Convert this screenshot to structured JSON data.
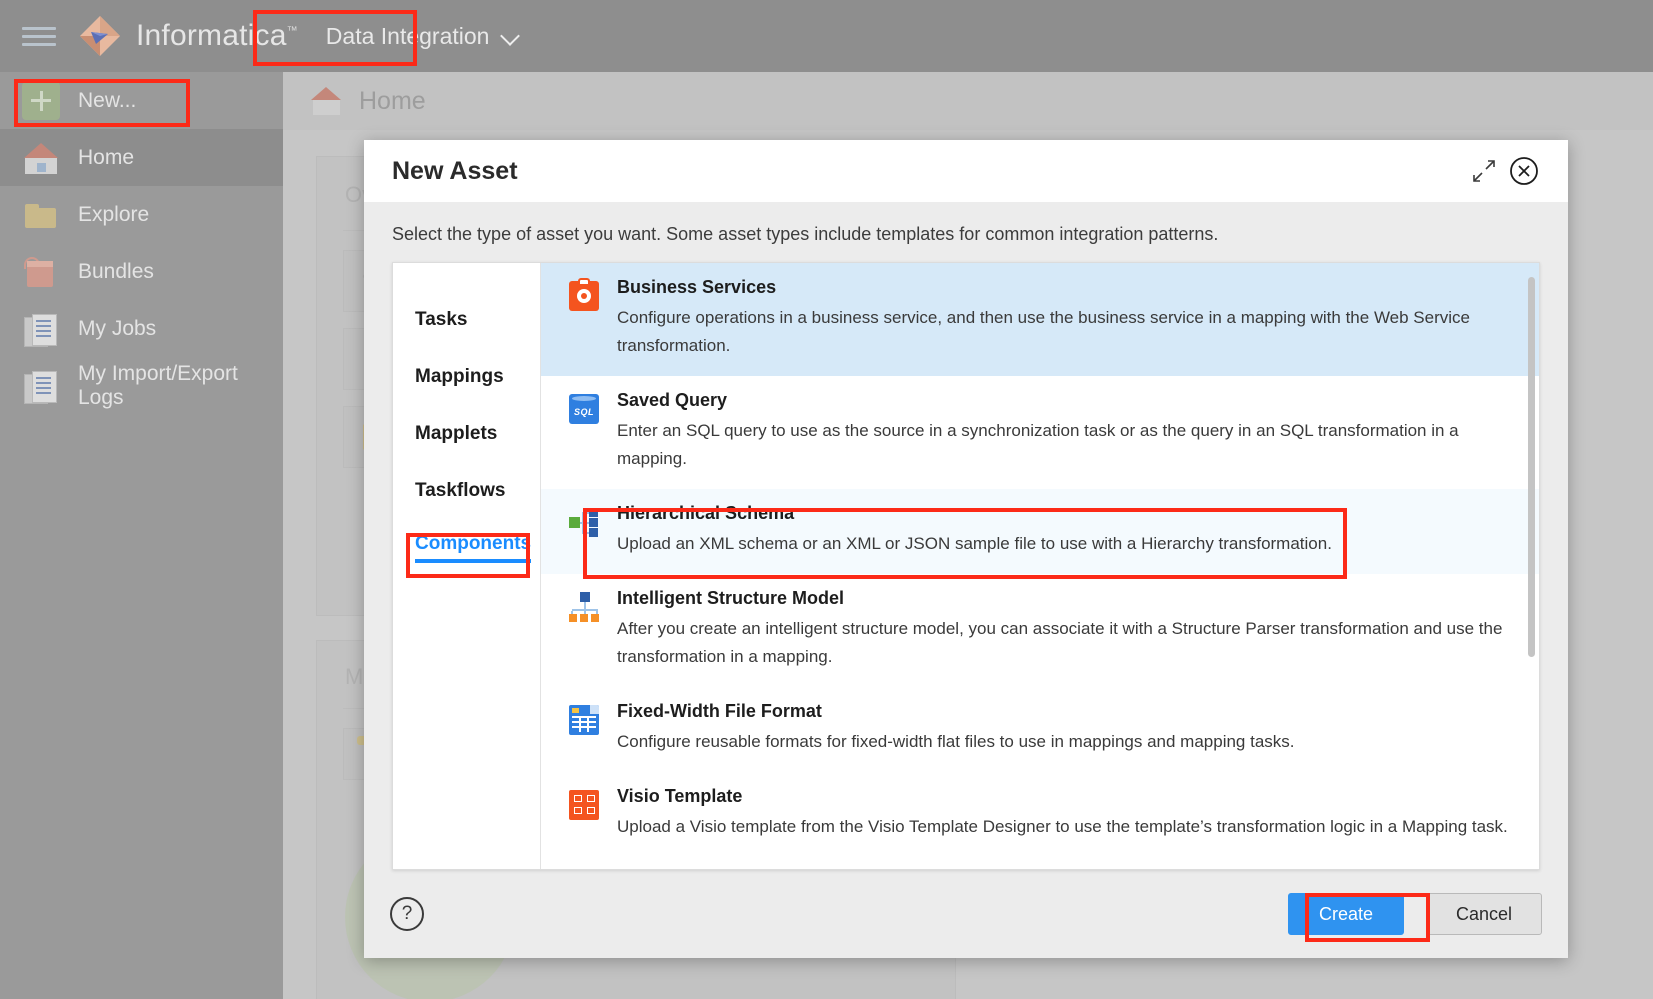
{
  "topbar": {
    "menu_icon": "hamburger-icon",
    "brand": "Informatica",
    "brand_tm": "™",
    "service_selector": "Data Integration",
    "chevron_icon": "chevron-down-icon"
  },
  "sidebar": {
    "items": [
      {
        "label": "New...",
        "icon": "plus-icon"
      },
      {
        "label": "Home",
        "icon": "home-icon"
      },
      {
        "label": "Explore",
        "icon": "folder-icon"
      },
      {
        "label": "Bundles",
        "icon": "bundle-box-icon"
      },
      {
        "label": "My Jobs",
        "icon": "documents-icon"
      },
      {
        "label": "My Import/Export Logs",
        "icon": "documents-icon"
      }
    ]
  },
  "background": {
    "breadcrumb": "Home",
    "breadcrumb_icon": "home-icon",
    "panel_overview_title": "Ov",
    "panel_more_title": "Mo"
  },
  "dialog": {
    "title": "New Asset",
    "expand_icon": "expand-diagonal-icon",
    "close_icon": "close-circle-icon",
    "subtitle": "Select the type of asset you want. Some asset types include templates for common integration patterns.",
    "categories": [
      {
        "label": "Tasks"
      },
      {
        "label": "Mappings"
      },
      {
        "label": "Mapplets"
      },
      {
        "label": "Taskflows"
      },
      {
        "label": "Components"
      }
    ],
    "selected_category": "Components",
    "assets": [
      {
        "name": "Business Services",
        "desc": "Configure operations in a business service, and then use the business service in a mapping with the Web Service transformation.",
        "icon": "business-services-icon"
      },
      {
        "name": "Saved Query",
        "desc": "Enter an SQL query to use as the source in a synchronization task or as the query in an SQL transformation in a mapping.",
        "icon": "saved-query-sql-icon"
      },
      {
        "name": "Hierarchical Schema",
        "desc": "Upload an XML schema or an XML or JSON sample file to use with a Hierarchy transformation.",
        "icon": "hierarchical-schema-icon"
      },
      {
        "name": "Intelligent Structure Model",
        "desc": "After you create an intelligent structure model, you can associate it with a Structure Parser transformation and use the transformation in a mapping.",
        "icon": "intelligent-structure-model-icon"
      },
      {
        "name": "Fixed-Width File Format",
        "desc": "Configure reusable formats for fixed-width flat files to use in mappings and mapping tasks.",
        "icon": "fixed-width-file-icon"
      },
      {
        "name": "Visio Template",
        "desc": "Upload a Visio template from the Visio Template Designer to use the template’s transformation logic in a Mapping task.",
        "icon": "visio-template-icon"
      }
    ],
    "footer": {
      "help_icon": "help-question-icon",
      "help_glyph": "?",
      "create_label": "Create",
      "cancel_label": "Cancel"
    }
  },
  "colors": {
    "accent_blue": "#2f93f0",
    "link_blue": "#1a8cff",
    "highlight_row": "#d6e9f8",
    "annotation_red": "#fc2a18",
    "orange": "#f4541f",
    "green": "#5aab3c"
  },
  "sql_badge": "SQL"
}
